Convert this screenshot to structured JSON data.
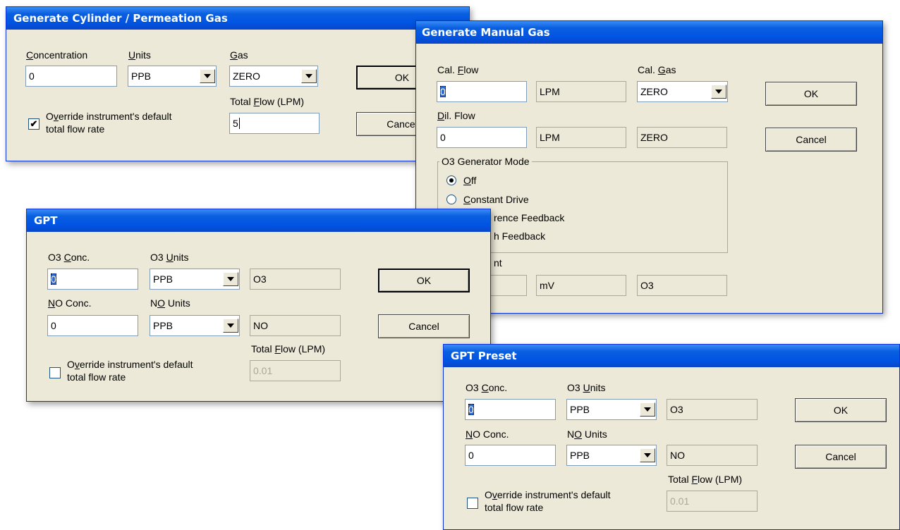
{
  "cylinder": {
    "title": "Generate Cylinder / Permeation Gas",
    "concentration_label_ul": "C",
    "concentration_label_rest": "oncentration",
    "concentration_value": "0",
    "units_label_ul": "U",
    "units_label_rest": "nits",
    "units_value": "PPB",
    "gas_label_ul": "G",
    "gas_label_rest": "as",
    "gas_value": "ZERO",
    "total_flow_label_pre": "Total ",
    "total_flow_label_ul": "F",
    "total_flow_label_post": "low (LPM)",
    "total_flow_value": "5",
    "override_label_line1_pre": "O",
    "override_label_line1_ul": "v",
    "override_label_line1_post": "erride instrument's default",
    "override_label_line2": "total flow rate",
    "override_checked": "✔",
    "ok_label": "OK",
    "cancel_label": "Cancel"
  },
  "manual": {
    "title": "Generate Manual Gas",
    "cal_flow_label_pre": "Cal. ",
    "cal_flow_label_ul": "F",
    "cal_flow_label_post": "low",
    "cal_flow_value": "0",
    "cal_flow_unit": "LPM",
    "cal_gas_label_pre": "Cal. ",
    "cal_gas_label_ul": "G",
    "cal_gas_label_post": "as",
    "cal_gas_value": "ZERO",
    "dil_flow_label_ul": "D",
    "dil_flow_label_post": "il. Flow",
    "dil_flow_value": "0",
    "dil_flow_unit": "LPM",
    "dil_gas_value": "ZERO",
    "o3_group_title": "O3 Generator Mode",
    "mode_off_ul": "O",
    "mode_off_post": "ff",
    "mode_constant_ul": "C",
    "mode_constant_post": "onstant Drive",
    "mode_reference": "rence Feedback",
    "mode_bench": "h Feedback",
    "setpoint_label": "nt",
    "setpoint_unit": "mV",
    "setpoint_gas": "O3",
    "ok_label": "OK",
    "cancel_label": "Cancel"
  },
  "gpt": {
    "title": "GPT",
    "o3_conc_label_pre": "O3 ",
    "o3_conc_label_ul": "C",
    "o3_conc_label_post": "onc.",
    "o3_conc_value": "0",
    "o3_units_label_pre": "O3 ",
    "o3_units_label_ul": "U",
    "o3_units_label_post": "nits",
    "o3_units_value": "PPB",
    "o3_gas": "O3",
    "no_conc_label_ul": "N",
    "no_conc_label_post": "O Conc.",
    "no_conc_value": "0",
    "no_units_label_pre": "N",
    "no_units_label_ul": "O",
    "no_units_label_post": " Units",
    "no_units_value": "PPB",
    "no_gas": "NO",
    "total_flow_label_pre": "Total ",
    "total_flow_label_ul": "F",
    "total_flow_label_post": "low (LPM)",
    "total_flow_value": "0.01",
    "override_label_line1_pre": "O",
    "override_label_line1_ul": "v",
    "override_label_line1_post": "erride instrument's default",
    "override_label_line2": "total flow rate",
    "ok_label": "OK",
    "cancel_label": "Cancel"
  },
  "preset": {
    "title": "GPT Preset",
    "o3_conc_label_pre": "O3 ",
    "o3_conc_label_ul": "C",
    "o3_conc_label_post": "onc.",
    "o3_conc_value": "0",
    "o3_units_label_pre": "O3 ",
    "o3_units_label_ul": "U",
    "o3_units_label_post": "nits",
    "o3_units_value": "PPB",
    "o3_gas": "O3",
    "no_conc_label_ul": "N",
    "no_conc_label_post": "O Conc.",
    "no_conc_value": "0",
    "no_units_label_pre": "N",
    "no_units_label_ul": "O",
    "no_units_label_post": " Units",
    "no_units_value": "PPB",
    "no_gas": "NO",
    "total_flow_label_pre": "Total ",
    "total_flow_label_ul": "F",
    "total_flow_label_post": "low (LPM)",
    "total_flow_value": "0.01",
    "override_label_line1_pre": "O",
    "override_label_line1_ul": "v",
    "override_label_line1_post": "erride instrument's default",
    "override_label_line2": "total flow rate",
    "ok_label": "OK",
    "cancel_label": "Cancel"
  }
}
